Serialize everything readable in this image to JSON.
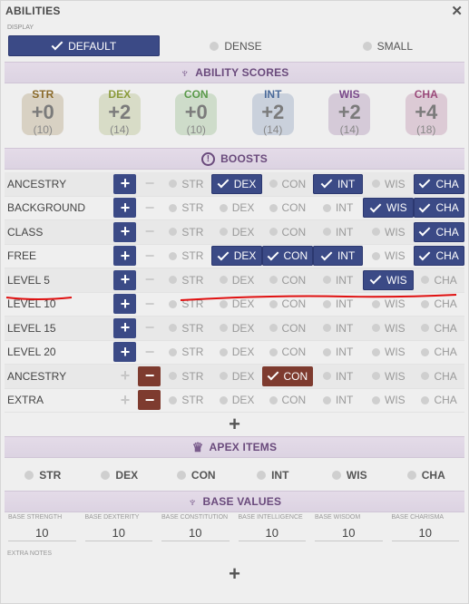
{
  "window": {
    "title": "ABILITIES",
    "close_icon": "close-icon"
  },
  "display": {
    "label": "DISPLAY",
    "options": [
      {
        "label": "DEFAULT",
        "selected": true
      },
      {
        "label": "DENSE",
        "selected": false
      },
      {
        "label": "SMALL",
        "selected": false
      }
    ]
  },
  "ability_scores": {
    "heading": "ABILITY SCORES",
    "icon": "ability-scores-icon",
    "items": [
      {
        "abbr": "STR",
        "mod": "+0",
        "value": "(10)",
        "color": "#8a6a2a",
        "icon": "strength-icon"
      },
      {
        "abbr": "DEX",
        "mod": "+2",
        "value": "(14)",
        "color": "#8a9a3a",
        "icon": "dexterity-icon"
      },
      {
        "abbr": "CON",
        "mod": "+0",
        "value": "(10)",
        "color": "#5a9a4a",
        "icon": "constitution-icon"
      },
      {
        "abbr": "INT",
        "mod": "+2",
        "value": "(14)",
        "color": "#4a6a9a",
        "icon": "intelligence-icon"
      },
      {
        "abbr": "WIS",
        "mod": "+2",
        "value": "(14)",
        "color": "#7a4a8a",
        "icon": "wisdom-icon"
      },
      {
        "abbr": "CHA",
        "mod": "+4",
        "value": "(18)",
        "color": "#9a4a7a",
        "icon": "charisma-icon"
      }
    ]
  },
  "boosts": {
    "heading": "BOOSTS",
    "icon": "boosts-icon",
    "abilities": [
      "STR",
      "DEX",
      "CON",
      "INT",
      "WIS",
      "CHA"
    ],
    "rows": [
      {
        "label": "ANCESTRY",
        "plus_active": true,
        "minus_active": false,
        "selected": [
          "DEX",
          "INT",
          "CHA"
        ],
        "flaw": []
      },
      {
        "label": "BACKGROUND",
        "plus_active": true,
        "minus_active": false,
        "selected": [
          "WIS",
          "CHA"
        ],
        "flaw": []
      },
      {
        "label": "CLASS",
        "plus_active": true,
        "minus_active": false,
        "selected": [
          "CHA"
        ],
        "flaw": []
      },
      {
        "label": "FREE",
        "plus_active": true,
        "minus_active": false,
        "selected": [
          "DEX",
          "CON",
          "INT",
          "CHA"
        ],
        "flaw": []
      },
      {
        "label": "LEVEL 5",
        "plus_active": true,
        "minus_active": false,
        "selected": [
          "WIS"
        ],
        "flaw": []
      },
      {
        "label": "LEVEL 10",
        "plus_active": true,
        "minus_active": false,
        "selected": [],
        "flaw": []
      },
      {
        "label": "LEVEL 15",
        "plus_active": true,
        "minus_active": false,
        "selected": [],
        "flaw": []
      },
      {
        "label": "LEVEL 20",
        "plus_active": true,
        "minus_active": false,
        "selected": [],
        "flaw": []
      },
      {
        "label": "ANCESTRY",
        "plus_active": false,
        "minus_active": true,
        "selected": [],
        "flaw": [
          "CON"
        ]
      },
      {
        "label": "EXTRA",
        "plus_active": false,
        "minus_active": true,
        "selected": [],
        "flaw": []
      }
    ],
    "add_label": "+"
  },
  "apex": {
    "heading": "APEX ITEMS",
    "icon": "crown-icon",
    "options": [
      "STR",
      "DEX",
      "CON",
      "INT",
      "WIS",
      "CHA"
    ]
  },
  "base_values": {
    "heading": "BASE VALUES",
    "icon": "base-values-icon",
    "items": [
      {
        "label": "BASE STRENGTH",
        "value": "10"
      },
      {
        "label": "BASE DEXTERITY",
        "value": "10"
      },
      {
        "label": "BASE CONSTITUTION",
        "value": "10"
      },
      {
        "label": "BASE INTELLIGENCE",
        "value": "10"
      },
      {
        "label": "BASE WISDOM",
        "value": "10"
      },
      {
        "label": "BASE CHARISMA",
        "value": "10"
      }
    ]
  },
  "extra_notes": {
    "label": "EXTRA NOTES",
    "add_label": "+"
  },
  "colors": {
    "accent": "#3b4a86",
    "flaw": "#7e3b2f",
    "section_text": "#6a4a7c",
    "annotation": "#e01010"
  }
}
